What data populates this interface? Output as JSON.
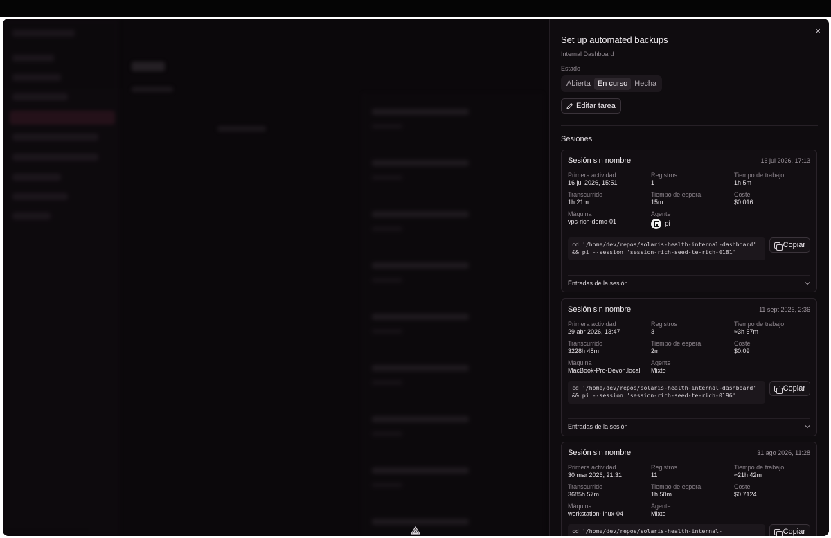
{
  "drawer": {
    "title": "Set up automated backups",
    "project": "Internal Dashboard",
    "state_label": "Estado",
    "state_options": [
      "Abierta",
      "En curso",
      "Hecha"
    ],
    "state_active": "En curso",
    "edit_label": "Editar tarea",
    "close_glyph": "×",
    "sessions_label": "Sesiones"
  },
  "labels": {
    "first_activity": "Primera actividad",
    "records": "Registros",
    "work_time": "Tiempo de trabajo",
    "elapsed": "Transcurrido",
    "wait_time": "Tiempo de espera",
    "cost": "Coste",
    "machine": "Máquina",
    "agent": "Agente",
    "copy": "Copiar",
    "entries": "Entradas de la sesión"
  },
  "sessions": [
    {
      "name": "Sesión sin nombre",
      "date": "16 jul 2026, 17:13",
      "first_activity": "16 jul 2026, 15:51",
      "records": "1",
      "work_time": "1h 5m",
      "elapsed": "1h 21m",
      "wait_time": "15m",
      "cost": "$0.016",
      "machine": "vps-rich-demo-01",
      "agent": "pi",
      "agent_icon": "pi-agent-icon",
      "command": "cd '/home/dev/repos/solaris-health-internal-dashboard' && pi --session 'session-rich-seed-te-rich-0181'"
    },
    {
      "name": "Sesión sin nombre",
      "date": "11 sept 2026, 2:36",
      "first_activity": "29 abr 2026, 13:47",
      "records": "3",
      "work_time": "≈3h 57m",
      "elapsed": "3228h 48m",
      "wait_time": "2m",
      "cost": "$0.09",
      "machine": "MacBook-Pro-Devon.local",
      "agent": "Mixto",
      "command": "cd '/home/dev/repos/solaris-health-internal-dashboard' && pi --session 'session-rich-seed-te-rich-0196'"
    },
    {
      "name": "Sesión sin nombre",
      "date": "31 ago 2026, 11:28",
      "first_activity": "30 mar 2026, 21:31",
      "records": "11",
      "work_time": "≈21h 42m",
      "elapsed": "3685h 57m",
      "wait_time": "1h 50m",
      "cost": "$0.7124",
      "machine": "workstation-linux-04",
      "agent": "Mixto",
      "command": "cd '/home/dev/repos/solaris-health-internal-"
    }
  ],
  "colors": {
    "background": "#0b080b",
    "drawer": "#0f0c0f",
    "card": "#120e12",
    "active_segment": "#2f292f"
  }
}
